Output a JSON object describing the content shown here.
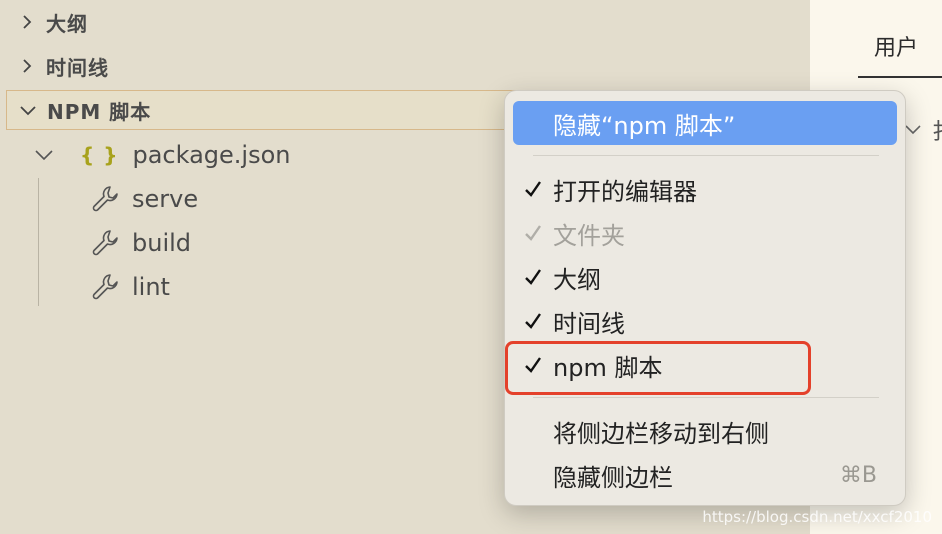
{
  "sidebar": {
    "sections": [
      {
        "title": "大纲",
        "expanded": false
      },
      {
        "title": "时间线",
        "expanded": false
      },
      {
        "title": "NPM 脚本",
        "expanded": true
      }
    ],
    "package": {
      "icon": "{ }",
      "name": "package.json"
    },
    "scripts": [
      {
        "label": "serve"
      },
      {
        "label": "build"
      },
      {
        "label": "lint"
      }
    ]
  },
  "editor": {
    "tab_label": "用户",
    "clipped_text": "扌"
  },
  "context_menu": {
    "items": [
      {
        "label": "隐藏“npm 脚本”",
        "checked": false,
        "state": "highlighted"
      },
      {
        "label": "打开的编辑器",
        "checked": true,
        "state": "normal"
      },
      {
        "label": "文件夹",
        "checked": true,
        "state": "disabled"
      },
      {
        "label": "大纲",
        "checked": true,
        "state": "normal"
      },
      {
        "label": "时间线",
        "checked": true,
        "state": "normal"
      },
      {
        "label": "npm 脚本",
        "checked": true,
        "state": "normal"
      },
      {
        "label": "将侧边栏移动到右侧",
        "checked": false,
        "state": "normal"
      },
      {
        "label": "隐藏侧边栏",
        "checked": false,
        "state": "normal",
        "shortcut": "⌘B"
      }
    ]
  },
  "watermark": "https://blog.csdn.net/xxcf2010",
  "colors": {
    "highlight": "#6a9ff2",
    "annotation_box": "#e4412b",
    "json_icon": "#a8a21c"
  }
}
